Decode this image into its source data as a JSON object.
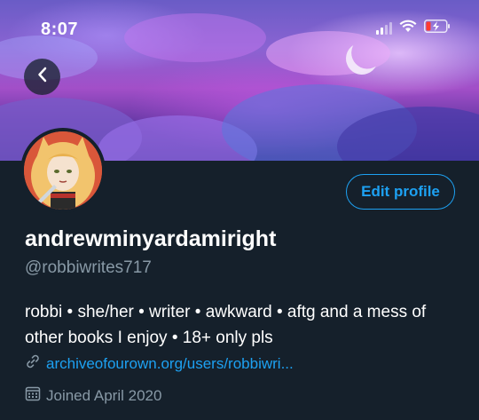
{
  "status_bar": {
    "time": "8:07",
    "icons": [
      "signal-icon",
      "wifi-icon",
      "battery-charging-icon"
    ]
  },
  "nav": {
    "back_icon": "chevron-left-icon"
  },
  "profile": {
    "display_name": "andrewminyardamiright",
    "handle": "@robbiwrites717",
    "bio": "robbi • she/her • writer • awkward • aftg and a mess of other books I enjoy • 18+ only pls",
    "link": "archiveofourown.org/users/robbiwri...",
    "joined": "Joined April 2020"
  },
  "actions": {
    "edit_profile_label": "Edit profile"
  },
  "colors": {
    "background": "#15202b",
    "accent": "#1da1f2",
    "secondary_text": "#8899a6",
    "battery_low": "#ff3b30"
  }
}
